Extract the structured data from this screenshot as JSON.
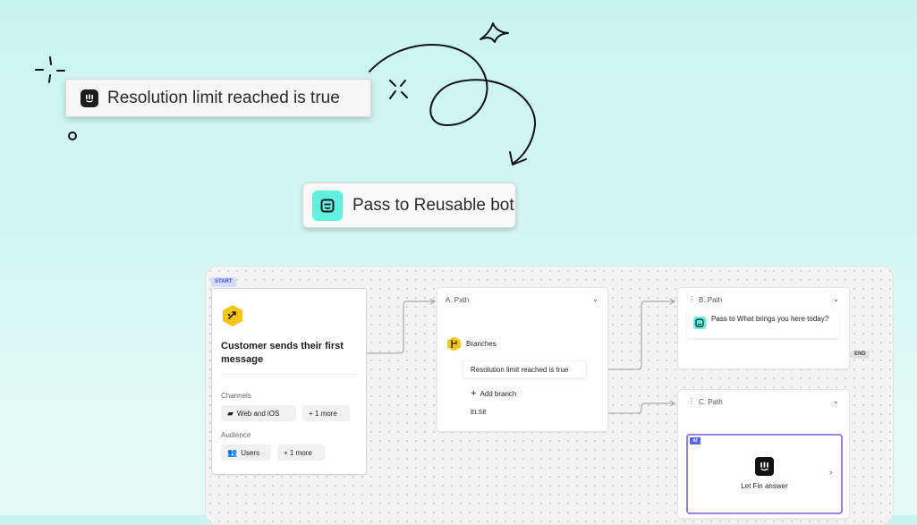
{
  "floating": {
    "condition_label": "Resolution limit reached is true",
    "action_label": "Pass to Reusable bot"
  },
  "start": {
    "badge": "START",
    "trigger_title": "Customer sends their first message",
    "channels_label": "Channels",
    "channels_value": "Web and iOS",
    "channels_more": "+ 1 more",
    "audience_label": "Audience",
    "audience_value": "Users",
    "audience_more": "+ 1 more"
  },
  "path_a": {
    "title": "A. Path",
    "branches_label": "Branches",
    "branch_condition": "Resolution limit reached is true",
    "add_branch": "Add branch",
    "else_label": "ELSE"
  },
  "path_b": {
    "title": "B. Path",
    "pass_prefix": "Pass to",
    "pass_text": "What brings you here today?",
    "end_tag": "END"
  },
  "path_c": {
    "title": "C. Path",
    "ai_tag": "AI",
    "fin_label": "Let Fin answer"
  },
  "colors": {
    "accent_yellow": "#f5c518",
    "teal": "#62f0e0",
    "fin_border": "#9a80e0",
    "ai_blue": "#5366e8"
  }
}
